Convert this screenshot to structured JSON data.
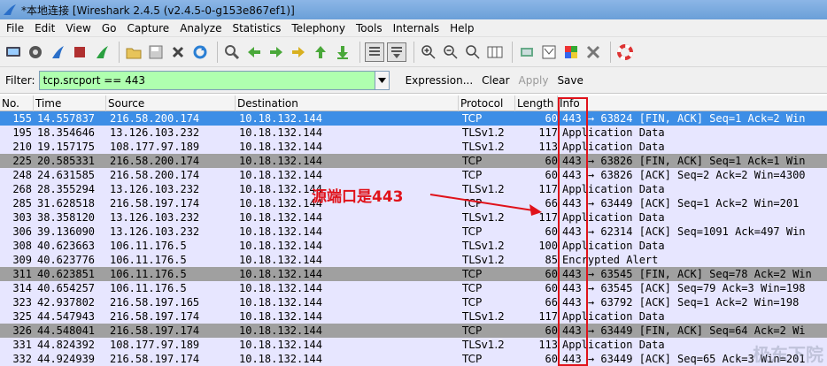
{
  "window": {
    "title": "*本地连接 [Wireshark 2.4.5 (v2.4.5-0-g153e867ef1)]"
  },
  "menu": [
    "File",
    "Edit",
    "View",
    "Go",
    "Capture",
    "Analyze",
    "Statistics",
    "Telephony",
    "Tools",
    "Internals",
    "Help"
  ],
  "filter": {
    "label": "Filter:",
    "value": "tcp.srcport == 443",
    "expression": "Expression...",
    "clear": "Clear",
    "apply": "Apply",
    "save": "Save"
  },
  "columns": [
    "No.",
    "Time",
    "Source",
    "Destination",
    "Protocol",
    "Length",
    "Info"
  ],
  "rows": [
    {
      "no": "155",
      "time": "14.557837",
      "src": "216.58.200.174",
      "dst": "10.18.132.144",
      "proto": "TCP",
      "len": "60",
      "info": "443 → 63824 [FIN, ACK] Seq=1 Ack=2 Win",
      "style": "selected"
    },
    {
      "no": "195",
      "time": "18.354646",
      "src": "13.126.103.232",
      "dst": "10.18.132.144",
      "proto": "TLSv1.2",
      "len": "117",
      "info": "Application Data",
      "style": "light"
    },
    {
      "no": "210",
      "time": "19.157175",
      "src": "108.177.97.189",
      "dst": "10.18.132.144",
      "proto": "TLSv1.2",
      "len": "113",
      "info": "Application Data",
      "style": "light"
    },
    {
      "no": "225",
      "time": "20.585331",
      "src": "216.58.200.174",
      "dst": "10.18.132.144",
      "proto": "TCP",
      "len": "60",
      "info": "443 → 63826 [FIN, ACK] Seq=1 Ack=1 Win",
      "style": "gray"
    },
    {
      "no": "248",
      "time": "24.631585",
      "src": "216.58.200.174",
      "dst": "10.18.132.144",
      "proto": "TCP",
      "len": "60",
      "info": "443 → 63826 [ACK] Seq=2 Ack=2 Win=4300",
      "style": "light"
    },
    {
      "no": "268",
      "time": "28.355294",
      "src": "13.126.103.232",
      "dst": "10.18.132.144",
      "proto": "TLSv1.2",
      "len": "117",
      "info": "Application Data",
      "style": "light"
    },
    {
      "no": "285",
      "time": "31.628518",
      "src": "216.58.197.174",
      "dst": "10.18.132.144",
      "proto": "TCP",
      "len": "66",
      "info": "443 → 63449 [ACK] Seq=1 Ack=2 Win=201",
      "style": "light"
    },
    {
      "no": "303",
      "time": "38.358120",
      "src": "13.126.103.232",
      "dst": "10.18.132.144",
      "proto": "TLSv1.2",
      "len": "117",
      "info": "Application Data",
      "style": "light"
    },
    {
      "no": "306",
      "time": "39.136090",
      "src": "13.126.103.232",
      "dst": "10.18.132.144",
      "proto": "TCP",
      "len": "60",
      "info": "443 → 62314 [ACK] Seq=1091 Ack=497 Win",
      "style": "light"
    },
    {
      "no": "308",
      "time": "40.623663",
      "src": "106.11.176.5",
      "dst": "10.18.132.144",
      "proto": "TLSv1.2",
      "len": "100",
      "info": "Application Data",
      "style": "light"
    },
    {
      "no": "309",
      "time": "40.623776",
      "src": "106.11.176.5",
      "dst": "10.18.132.144",
      "proto": "TLSv1.2",
      "len": "85",
      "info": "Encrypted Alert",
      "style": "light"
    },
    {
      "no": "311",
      "time": "40.623851",
      "src": "106.11.176.5",
      "dst": "10.18.132.144",
      "proto": "TCP",
      "len": "60",
      "info": "443 → 63545 [FIN, ACK] Seq=78 Ack=2 Win",
      "style": "gray"
    },
    {
      "no": "314",
      "time": "40.654257",
      "src": "106.11.176.5",
      "dst": "10.18.132.144",
      "proto": "TCP",
      "len": "60",
      "info": "443 → 63545 [ACK] Seq=79 Ack=3 Win=198",
      "style": "light"
    },
    {
      "no": "323",
      "time": "42.937802",
      "src": "216.58.197.165",
      "dst": "10.18.132.144",
      "proto": "TCP",
      "len": "66",
      "info": "443 → 63792 [ACK] Seq=1 Ack=2 Win=198",
      "style": "light"
    },
    {
      "no": "325",
      "time": "44.547943",
      "src": "216.58.197.174",
      "dst": "10.18.132.144",
      "proto": "TLSv1.2",
      "len": "117",
      "info": "Application Data",
      "style": "light"
    },
    {
      "no": "326",
      "time": "44.548041",
      "src": "216.58.197.174",
      "dst": "10.18.132.144",
      "proto": "TCP",
      "len": "60",
      "info": "443 → 63449 [FIN, ACK] Seq=64 Ack=2 Wi",
      "style": "gray"
    },
    {
      "no": "331",
      "time": "44.824392",
      "src": "108.177.97.189",
      "dst": "10.18.132.144",
      "proto": "TLSv1.2",
      "len": "113",
      "info": "Application Data",
      "style": "light"
    },
    {
      "no": "332",
      "time": "44.924939",
      "src": "216.58.197.174",
      "dst": "10.18.132.144",
      "proto": "TCP",
      "len": "60",
      "info": "443 → 63449 [ACK] Seq=65 Ack=3 Win=201",
      "style": "light"
    }
  ],
  "annotation": "源端口是443",
  "watermark": "极东下院",
  "colors": {
    "filter_ok": "#afffaf",
    "selected": "#3d8ee6",
    "row_light": "#e7e6ff",
    "row_gray": "#a0a0a0",
    "annotation": "#e0121a"
  }
}
